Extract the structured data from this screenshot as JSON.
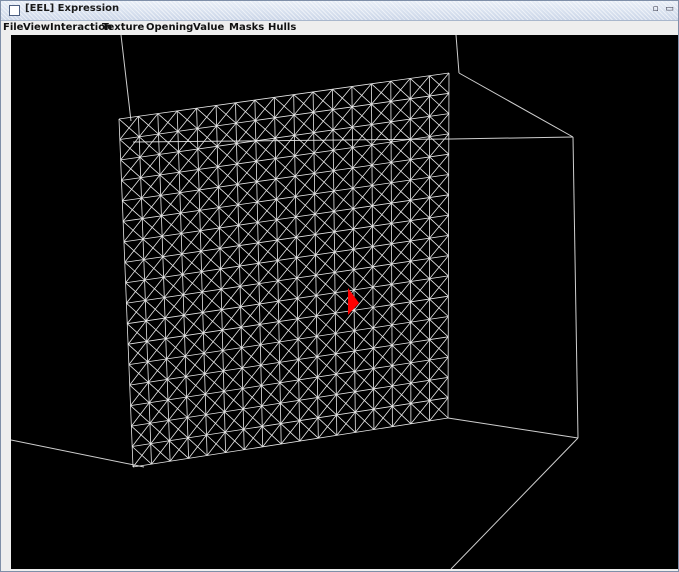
{
  "window": {
    "title": "[EEL] Expression"
  },
  "menu": {
    "items": [
      "File",
      "View",
      "Interaction",
      "Texture",
      "Opening",
      "Value",
      "Masks",
      "Hulls"
    ]
  },
  "icons": {
    "window_icon": "window-icon",
    "minimize": "minimize-icon",
    "maximize": "maximize-icon",
    "cursor": "triangle-cursor-icon"
  },
  "colors": {
    "canvas_background": "#000000",
    "mesh": "#ffffff",
    "cursor": "#ff0000"
  }
}
